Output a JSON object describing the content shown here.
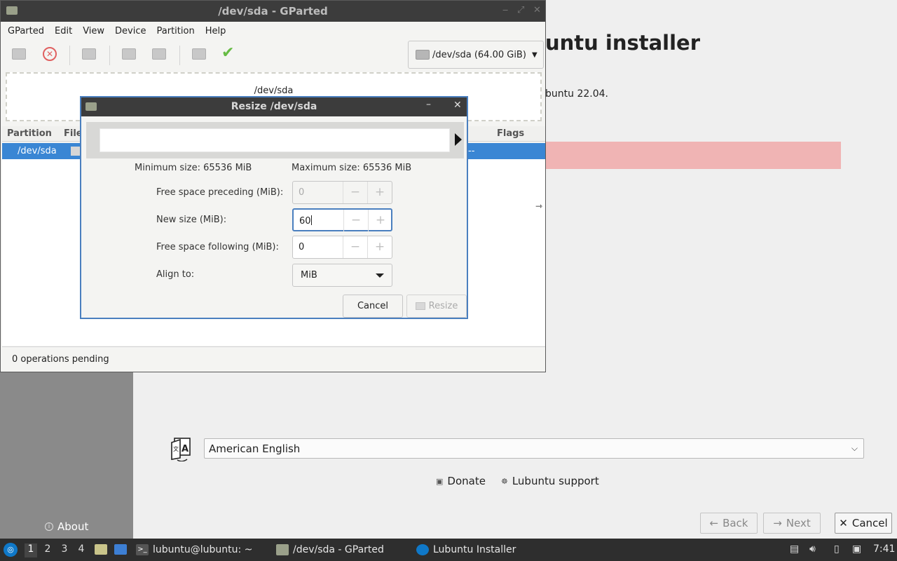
{
  "installer": {
    "title": "untu installer",
    "version_text": "buntu 22.04.",
    "about": "About",
    "language": "American English",
    "links": {
      "donate": "Donate",
      "support": "Lubuntu support"
    },
    "buttons": {
      "back": "Back",
      "next": "Next",
      "cancel": "Cancel"
    },
    "warning_color": "#f0b4b4"
  },
  "gparted": {
    "window_title": "/dev/sda - GParted",
    "menu": [
      "GParted",
      "Edit",
      "View",
      "Device",
      "Partition",
      "Help"
    ],
    "device_selector": "/dev/sda (64.00 GiB)",
    "disk_map_label": "/dev/sda",
    "columns": {
      "partition": "Partition",
      "filesystem": "File",
      "flags": "Flags"
    },
    "row": {
      "partition": "/dev/sda",
      "flags": "--"
    },
    "status": "0 operations pending",
    "selection_color": "#3a86d4"
  },
  "resize_dialog": {
    "title": "Resize /dev/sda",
    "min_size": "Minimum size: 65536 MiB",
    "max_size": "Maximum size: 65536 MiB",
    "labels": {
      "preceding": "Free space preceding (MiB):",
      "new_size": "New size (MiB):",
      "following": "Free space following (MiB):",
      "align": "Align to:"
    },
    "values": {
      "preceding": "0",
      "new_size": "60",
      "following": "0",
      "align": "MiB"
    },
    "buttons": {
      "cancel": "Cancel",
      "resize": "Resize"
    }
  },
  "taskbar": {
    "workspaces": [
      "1",
      "2",
      "3",
      "4"
    ],
    "tasks": {
      "terminal": "lubuntu@lubuntu: ~",
      "gparted": "/dev/sda - GParted",
      "installer": "Lubuntu Installer"
    },
    "clock": "7:41"
  }
}
